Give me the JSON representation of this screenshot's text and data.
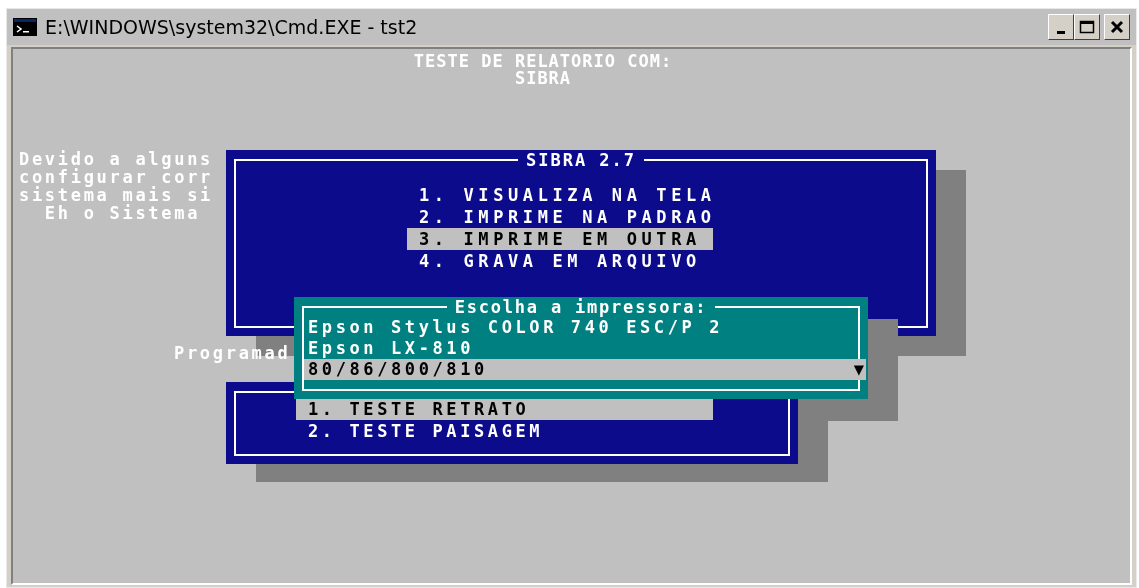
{
  "window": {
    "title": "E:\\WINDOWS\\system32\\Cmd.EXE - tst2"
  },
  "header_lines": [
    "TESTE DE RELATORIO COM:",
    "SIBRA"
  ],
  "background_lines": [
    "Devido a alguns",
    "configurar corr",
    "sistema mais si",
    "  Eh o Sistema"
  ],
  "footer_text": "Programad",
  "main_menu": {
    "title": "SIBRA 2.7",
    "items": [
      {
        "label": "1. VISUALIZA NA TELA",
        "selected": false
      },
      {
        "label": "2. IMPRIME NA PADRAO",
        "selected": false
      },
      {
        "label": "3. IMPRIME EM OUTRA",
        "selected": true
      },
      {
        "label": "4. GRAVA EM ARQUIVO",
        "selected": false
      }
    ]
  },
  "test_menu": {
    "items": [
      {
        "label": "1. TESTE RETRATO",
        "selected": true
      },
      {
        "label": "2. TESTE PAISAGEM",
        "selected": false
      }
    ]
  },
  "printer_popup": {
    "title": "Escolha a impressora:",
    "scroll_marker": "▼",
    "items": [
      {
        "label": "Epson Stylus COLOR 740 ESC/P 2",
        "selected": false
      },
      {
        "label": "Epson LX-810",
        "selected": false
      },
      {
        "label": "80/86/800/810",
        "selected": true
      }
    ]
  }
}
